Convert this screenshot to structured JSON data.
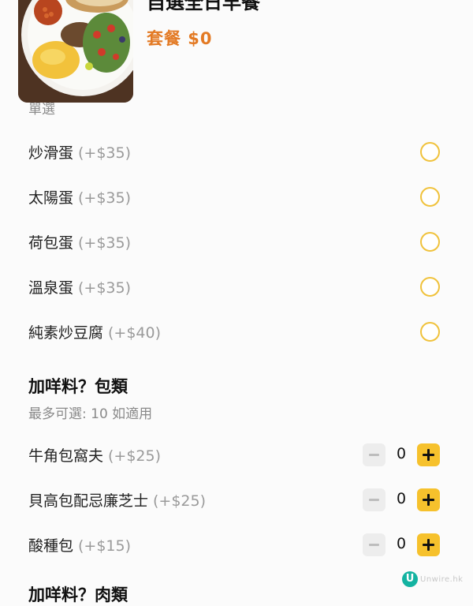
{
  "item": {
    "title": "自選全日早餐",
    "price": "套餐 $0",
    "image_name": "breakfast-plate-photo"
  },
  "egg_group": {
    "cut_label": "單選",
    "options": [
      {
        "label": "炒滑蛋",
        "price": "(+$35)"
      },
      {
        "label": "太陽蛋",
        "price": "(+$35)"
      },
      {
        "label": "荷包蛋",
        "price": "(+$35)"
      },
      {
        "label": "溫泉蛋",
        "price": "(+$35)"
      },
      {
        "label": "純素炒豆腐",
        "price": "(+$40)"
      }
    ]
  },
  "bread_group": {
    "title": "加咩料？包類",
    "subtitle": "最多可選: 10  如適用",
    "items": [
      {
        "label": "牛角包窩夫",
        "price": "(+$25)",
        "qty": "0"
      },
      {
        "label": "貝高包配忌廉芝士",
        "price": "(+$25)",
        "qty": "0"
      },
      {
        "label": "酸種包",
        "price": "(+$15)",
        "qty": "0"
      }
    ]
  },
  "next_section": {
    "title": "加咩料？肉類"
  },
  "watermark": {
    "icon_letter": "U",
    "text": "Unwire.hk"
  },
  "colors": {
    "accent": "#f6c12c",
    "price": "#e37a24",
    "radio_border": "#f0c23c"
  }
}
